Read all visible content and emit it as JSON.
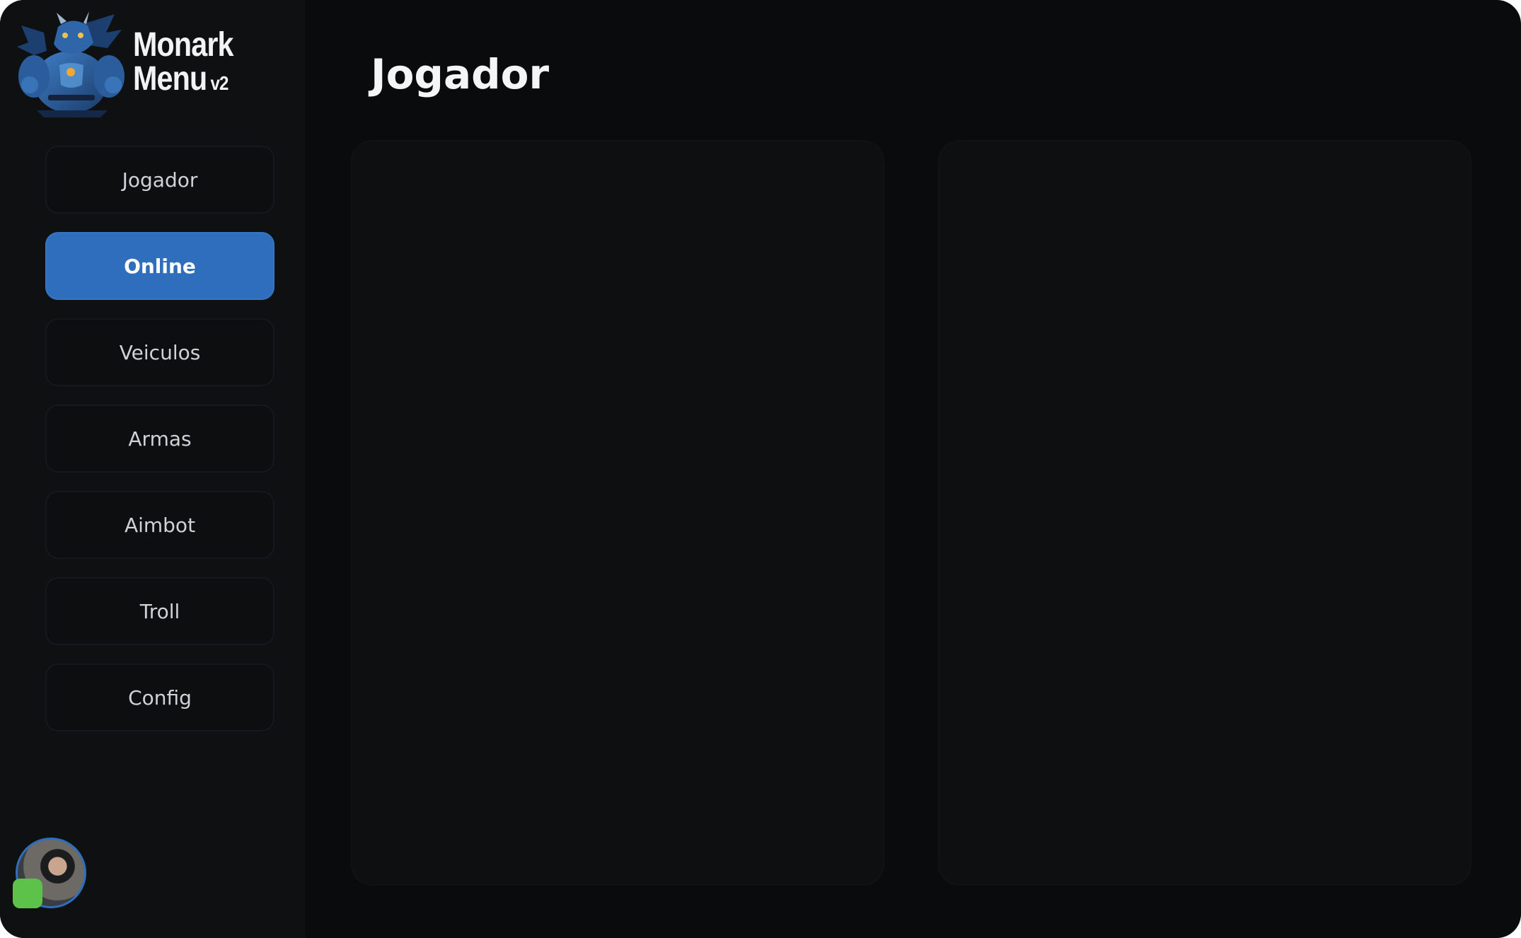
{
  "app": {
    "logo_line1": "Monark",
    "logo_line2": "Menu",
    "logo_version": "v2"
  },
  "header": {
    "title": "Jogador"
  },
  "sidebar": {
    "items": [
      {
        "label": "Jogador",
        "active": false
      },
      {
        "label": "Online",
        "active": true
      },
      {
        "label": "Veiculos",
        "active": false
      },
      {
        "label": "Armas",
        "active": false
      },
      {
        "label": "Aimbot",
        "active": false
      },
      {
        "label": "Troll",
        "active": false
      },
      {
        "label": "Config",
        "active": false
      }
    ]
  },
  "user": {
    "status_color": "#5cc24a"
  },
  "colors": {
    "accent": "#2f6ebd",
    "background": "#0a0b0c",
    "sidebar": "#0e1012",
    "panel": "#0e0f11",
    "status_online": "#5cc24a"
  },
  "icons": {
    "logo": "dragon-mascot-icon",
    "avatar": "user-avatar"
  }
}
